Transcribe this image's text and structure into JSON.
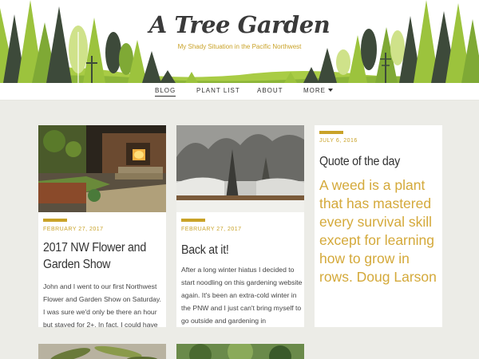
{
  "site": {
    "title": "A Tree Garden",
    "tagline": "My Shady Situation in the Pacific Northwest"
  },
  "nav": {
    "items": [
      {
        "label": "BLOG",
        "active": true
      },
      {
        "label": "PLANT LIST",
        "active": false
      },
      {
        "label": "ABOUT",
        "active": false
      },
      {
        "label": "MORE",
        "active": false
      }
    ]
  },
  "posts": [
    {
      "date": "FEBRUARY 27, 2017",
      "title": "2017 NW Flower and Garden Show",
      "excerpt": "John and I went to our first Northwest Flower and Garden Show on Saturday. I was sure we'd only be there an hour but stayed for 2+. In fact, I could have"
    },
    {
      "date": "FEBRUARY 27, 2017",
      "title": "Back at it!",
      "excerpt": "After a long winter hiatus I decided to start noodling on this gardening website again. It's been an extra-cold winter in the PNW and I just can't bring myself to go outside and gardening in"
    },
    {
      "date": "JULY 6, 2016",
      "title": "Quote of the day",
      "excerpt": "A weed is a plant that has mastered every survival skill except for learning how to grow in rows. Doug Larson"
    }
  ],
  "colors": {
    "accent": "#c9a227",
    "quote": "#d4a93a",
    "background": "#ecece7",
    "tree_green": "#9cc33d",
    "tree_dark": "#3d4a3a"
  }
}
